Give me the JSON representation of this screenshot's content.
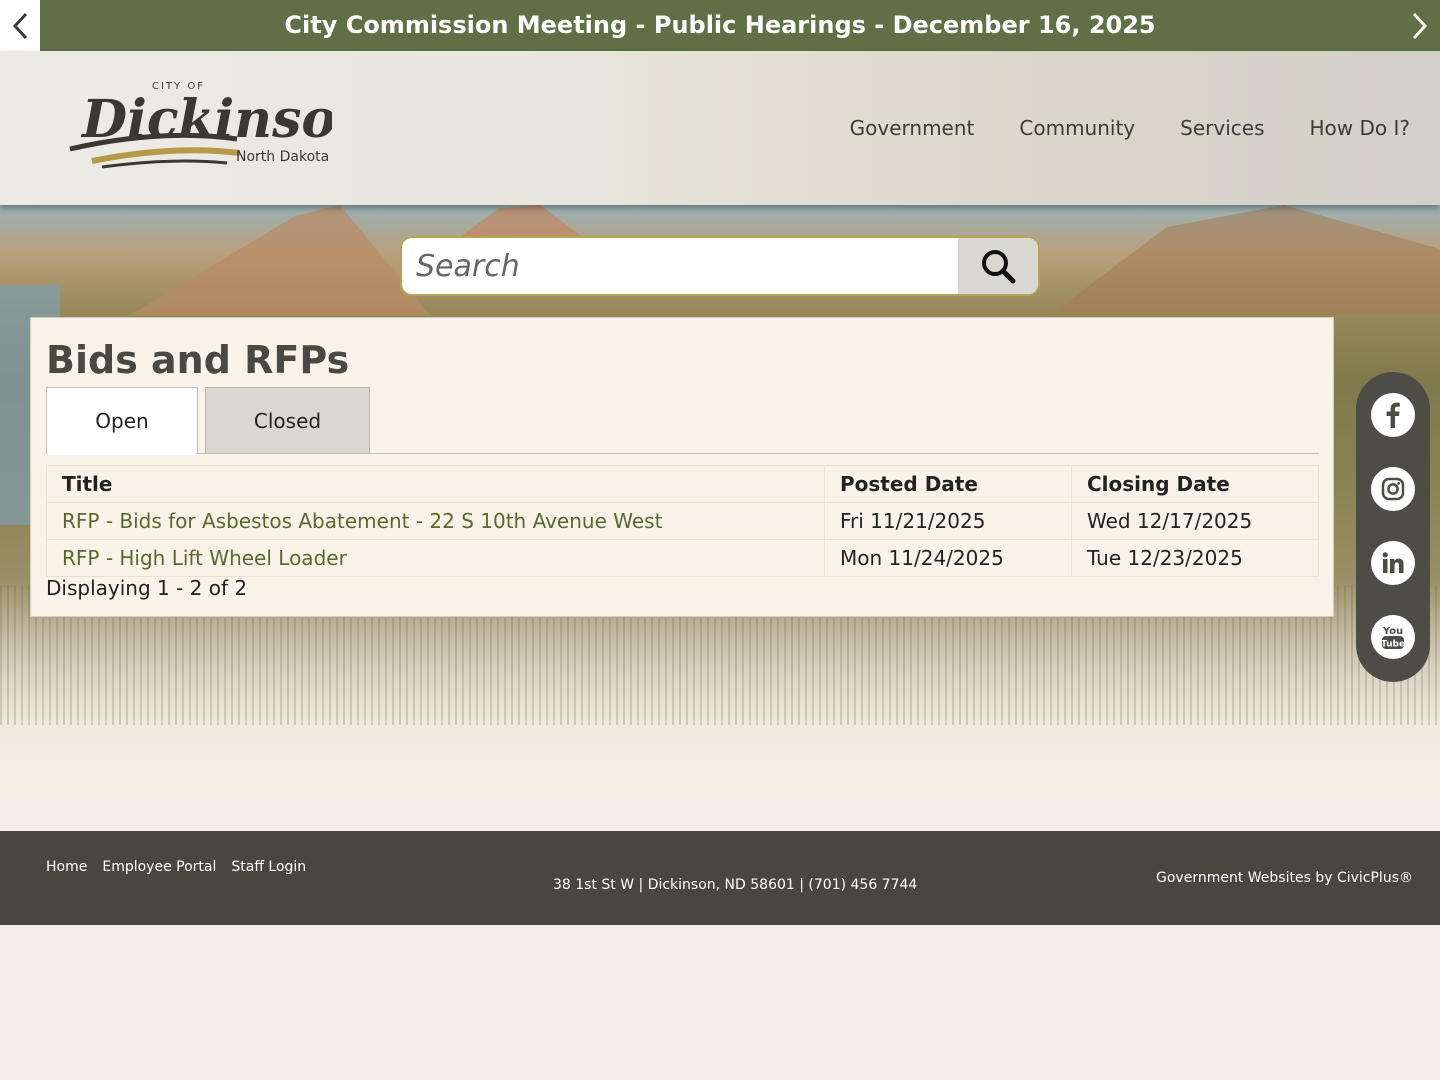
{
  "alert": {
    "text": "City Commission Meeting - Public Hearings - December 16, 2025",
    "prev_icon": "chevron-left-icon",
    "next_icon": "chevron-right-icon"
  },
  "logo": {
    "city_of": "CITY OF",
    "name": "Dickinson",
    "state": "North Dakota"
  },
  "nav": {
    "items": [
      "Government",
      "Community",
      "Services",
      "How Do I?"
    ]
  },
  "search": {
    "placeholder": "Search",
    "icon": "search-icon"
  },
  "main": {
    "title": "Bids and RFPs",
    "tabs": [
      "Open",
      "Closed"
    ],
    "active_tab": "Open",
    "table": {
      "headers": [
        "Title",
        "Posted Date",
        "Closing Date"
      ],
      "rows": [
        {
          "title": "RFP - Bids for Asbestos Abatement - 22 S 10th Avenue West",
          "posted": "Fri 11/21/2025",
          "closing": "Wed 12/17/2025"
        },
        {
          "title": "RFP - High Lift Wheel Loader",
          "posted": "Mon 11/24/2025",
          "closing": "Tue 12/23/2025"
        }
      ]
    },
    "displaying": "Displaying 1 - 2 of 2"
  },
  "social": {
    "icons": [
      "facebook-icon",
      "instagram-icon",
      "linkedin-icon",
      "youtube-icon"
    ]
  },
  "footer": {
    "links": [
      "Home",
      "Employee Portal",
      "Staff Login"
    ],
    "address": "38 1st St W |  Dickinson, ND 58601 | (701) 456 7744",
    "credit": "Government Websites by CivicPlus®"
  },
  "colors": {
    "alert_bg": "#5f6f46",
    "link": "#59692f",
    "footer_bg": "#49463f",
    "search_border": "#b5a455",
    "page_bg": "#f4efe6"
  }
}
